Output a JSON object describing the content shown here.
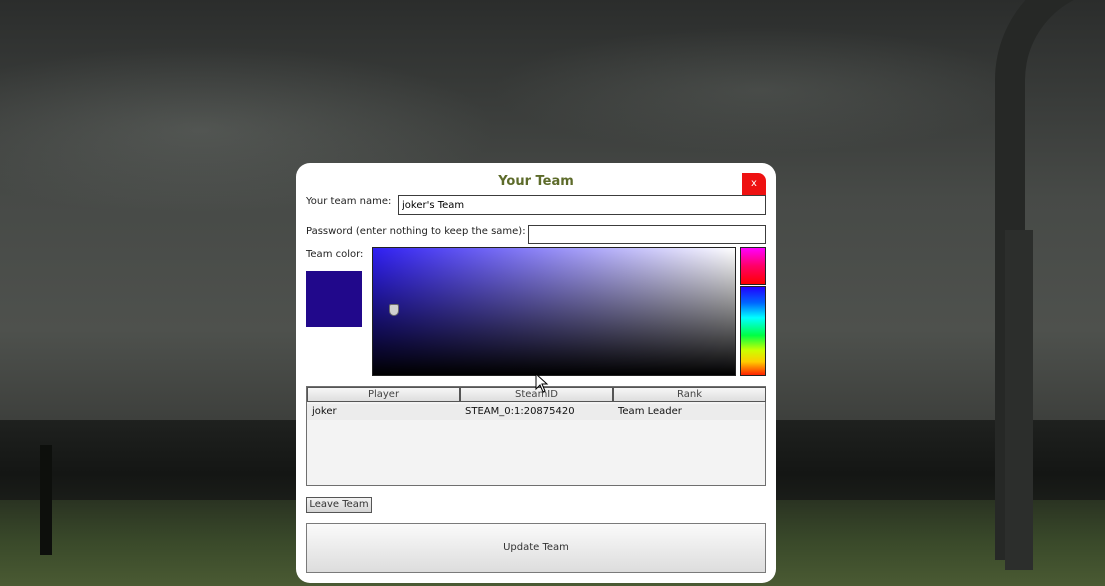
{
  "dialog": {
    "title": "Your Team",
    "close_label": "x",
    "team_name_label": "Your team name:",
    "team_name_value": "joker's Team",
    "password_label": "Password (enter nothing to keep the same):",
    "password_value": "",
    "team_color_label": "Team color:",
    "team_color": "#21088b",
    "picker_base_color": "#2f1ff2",
    "table": {
      "columns": [
        "Player",
        "SteamID",
        "Rank"
      ],
      "rows": [
        {
          "player": "joker",
          "steamid": "STEAM_0:1:20875420",
          "rank": "Team Leader"
        }
      ]
    },
    "leave_button": "Leave Team",
    "update_button": "Update Team"
  },
  "colors": {
    "title": "#5d6b2a",
    "close_button": "#ee1111"
  },
  "icons": {
    "cursor": "arrow-cursor-icon"
  }
}
